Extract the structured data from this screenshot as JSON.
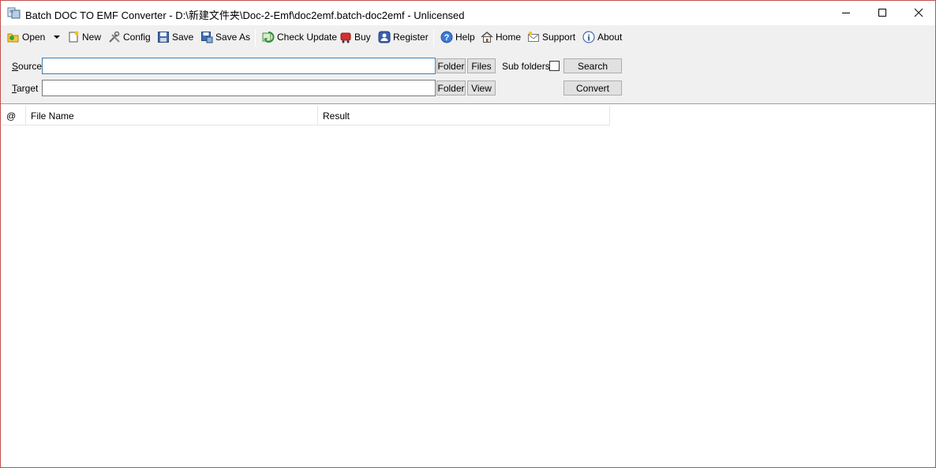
{
  "window": {
    "title": "Batch DOC TO EMF Converter - D:\\新建文件夹\\Doc-2-Emf\\doc2emf.batch-doc2emf - Unlicensed"
  },
  "toolbar": {
    "open": "Open",
    "new": "New",
    "config": "Config",
    "save": "Save",
    "save_as": "Save As",
    "check_update": "Check Update",
    "buy": "Buy",
    "register": "Register",
    "help": "Help",
    "home": "Home",
    "support": "Support",
    "about": "About"
  },
  "panel": {
    "source_label_key": "S",
    "source_label_rest": "ource",
    "target_label_key": "T",
    "target_label_rest": "arget",
    "source_value": "",
    "target_value": "",
    "folder_label": "Folder",
    "files_label": "Files",
    "view_label": "View",
    "subfolders_label": "Sub folders",
    "search_label": "Search",
    "convert_label": "Convert"
  },
  "list": {
    "columns": [
      "@",
      "File Name",
      "Result"
    ]
  },
  "colors": {
    "window_border": "#c0504d",
    "toolbar_bg": "#f0f0f0",
    "button_bg": "#e1e1e1",
    "input_focus": "#3c7fb1"
  }
}
